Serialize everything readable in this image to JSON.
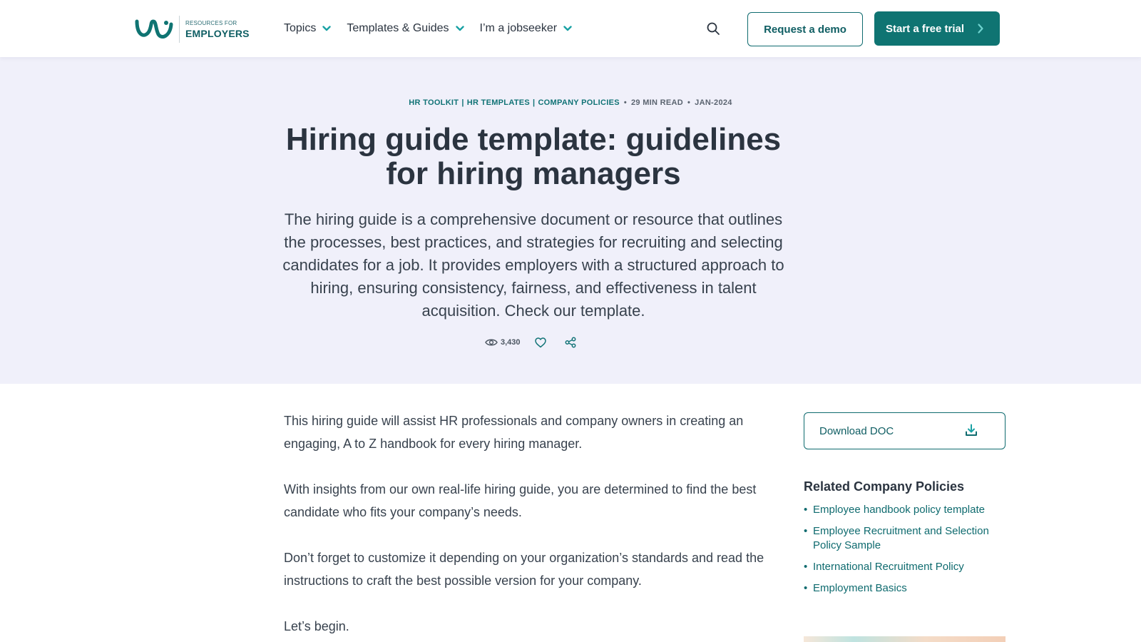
{
  "brand": {
    "small": "RESOURCES FOR",
    "big": "EMPLOYERS",
    "accent": "#0f7472"
  },
  "nav": [
    {
      "label": "Topics"
    },
    {
      "label": "Templates & Guides"
    },
    {
      "label": "I’m a jobseeker"
    }
  ],
  "header": {
    "demo_label": "Request a demo",
    "trial_label": "Start a free trial"
  },
  "hero": {
    "categories": [
      "HR TOOLKIT",
      "HR TEMPLATES",
      "COMPANY POLICIES"
    ],
    "read_time": "29 MIN READ",
    "date": "JAN-2024",
    "title": "Hiring guide template: guidelines for hiring managers",
    "intro": "The hiring guide is a comprehensive document or resource that outlines the processes, best practices, and strategies for recruiting and selecting candidates for a job. It provides employers with a structured approach to hiring, ensuring consistency, fairness, and effectiveness in talent acquisition. Check our template.",
    "views": "3,430"
  },
  "article": {
    "paragraphs": [
      "This hiring guide will assist HR professionals and company owners in creating an engaging, A to Z handbook for every hiring manager.",
      "With insights from our own real-life hiring guide, you are determined to find the best candidate who fits your company’s needs.",
      "Don’t forget to customize it depending on your organization’s standards and read the instructions to craft the best possible version for your company.",
      "Let’s begin."
    ]
  },
  "sidebar": {
    "download_label": "Download DOC",
    "related_title": "Related Company Policies",
    "related": [
      "Employee handbook policy template",
      "Employee Recruitment and Selection Policy Sample",
      "International Recruitment Policy",
      "Employment Basics"
    ]
  }
}
